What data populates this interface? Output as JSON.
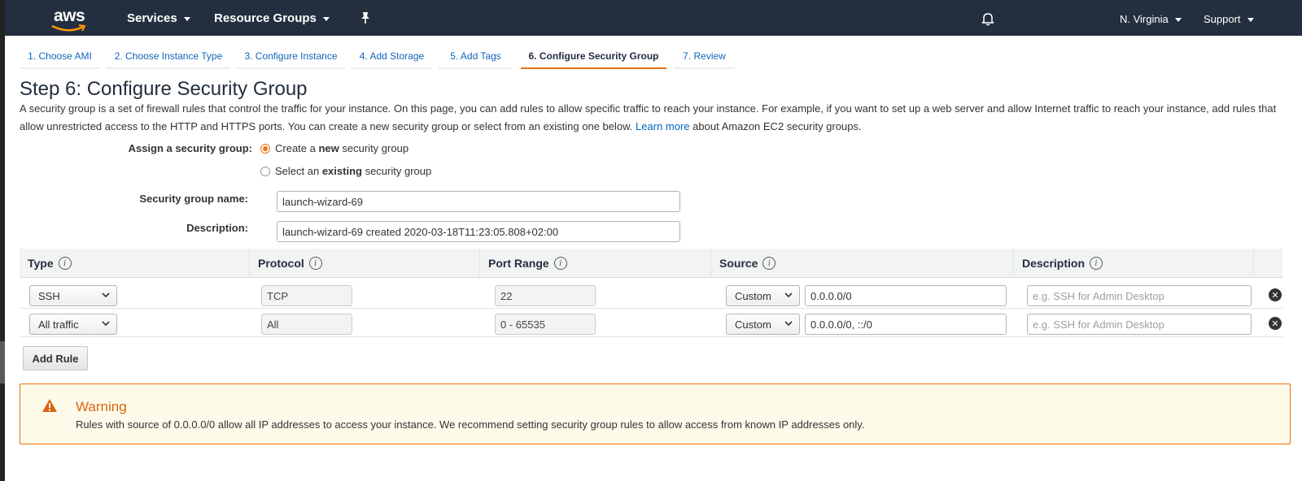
{
  "nav": {
    "logo_text": "aws",
    "services": "Services",
    "resource_groups": "Resource Groups",
    "region": "N. Virginia",
    "support": "Support"
  },
  "steps": [
    "1. Choose AMI",
    "2. Choose Instance Type",
    "3. Configure Instance",
    "4. Add Storage",
    "5. Add Tags",
    "6. Configure Security Group",
    "7. Review"
  ],
  "active_step": "6. Configure Security Group",
  "page": {
    "title": "Step 6: Configure Security Group",
    "intro_1": "A security group is a set of firewall rules that control the traffic for your instance. On this page, you can add rules to allow specific traffic to reach your instance. For example, if you want to set up a web server and allow Internet traffic to reach your instance,",
    "intro_2": "add rules that allow unrestricted access to the HTTP and HTTPS ports. You can create a new security group or select from an existing one below.",
    "learn_more": "Learn more",
    "intro_3": "about Amazon EC2 security groups."
  },
  "form": {
    "assign_label": "Assign a security group:",
    "option_new_pre": "Create a ",
    "option_new_bold": "new",
    "option_new_post": " security group",
    "option_existing_pre": "Select an ",
    "option_existing_bold": "existing",
    "option_existing_post": " security group",
    "selected_option": "new",
    "name_label": "Security group name:",
    "name_value": "launch-wizard-69",
    "desc_label": "Description:",
    "desc_value": "launch-wizard-69 created 2020-03-18T11:23:05.808+02:00"
  },
  "table": {
    "headers": [
      "Type",
      "Protocol",
      "Port Range",
      "Source",
      "Description"
    ],
    "rows": [
      {
        "type": "SSH",
        "protocol": "TCP",
        "port_range": "22",
        "source_mode": "Custom",
        "source_value": "0.0.0.0/0",
        "description_placeholder": "e.g. SSH for Admin Desktop"
      },
      {
        "type": "All traffic",
        "protocol": "All",
        "port_range": "0 - 65535",
        "source_mode": "Custom",
        "source_value": "0.0.0.0/0, ::/0",
        "description_placeholder": "e.g. SSH for Admin Desktop"
      }
    ]
  },
  "add_rule_label": "Add Rule",
  "warning": {
    "title": "Warning",
    "text": "Rules with source of 0.0.0.0/0 allow all IP addresses to access your instance. We recommend setting security group rules to allow access from known IP addresses only."
  },
  "colors": {
    "nav_bg": "#232f3e",
    "accent": "#ec7211",
    "link": "#0066c0",
    "warning_bg": "#fefaea"
  }
}
